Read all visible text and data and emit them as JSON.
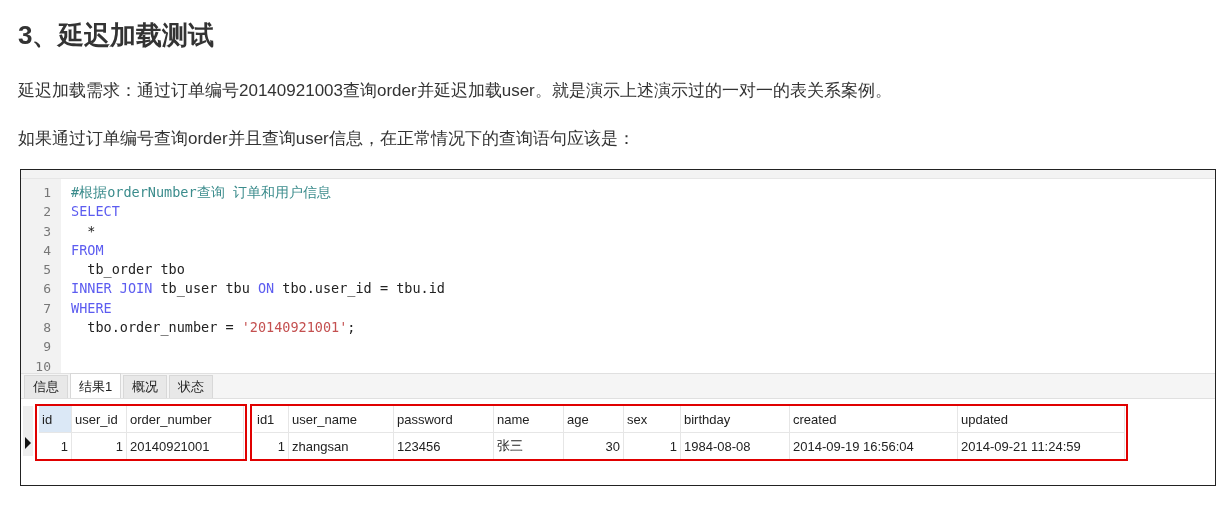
{
  "heading": "3、延迟加载测试",
  "paragraphs": [
    "延迟加载需求：通过订单编号20140921003查询order并延迟加载user。就是演示上述演示过的一对一的表关系案例。",
    "如果通过订单编号查询order并且查询user信息，在正常情况下的查询语句应该是："
  ],
  "editor": {
    "lines": [
      {
        "number": "1",
        "tokens": [
          {
            "kind": "comment",
            "text": "#根据orderNumber查询 订单和用户信息"
          }
        ]
      },
      {
        "number": "2",
        "tokens": [
          {
            "kind": "keyword",
            "text": "SELECT"
          }
        ]
      },
      {
        "number": "3",
        "tokens": [
          {
            "kind": "plain",
            "text": "  *"
          }
        ]
      },
      {
        "number": "4",
        "tokens": [
          {
            "kind": "keyword",
            "text": "FROM"
          }
        ]
      },
      {
        "number": "5",
        "tokens": [
          {
            "kind": "plain",
            "text": "  tb_order tbo"
          }
        ]
      },
      {
        "number": "6",
        "tokens": [
          {
            "kind": "keyword",
            "text": "INNER JOIN"
          },
          {
            "kind": "plain",
            "text": " tb_user tbu "
          },
          {
            "kind": "keyword",
            "text": "ON"
          },
          {
            "kind": "plain",
            "text": " tbo.user_id = tbu.id"
          }
        ]
      },
      {
        "number": "7",
        "tokens": [
          {
            "kind": "keyword",
            "text": "WHERE"
          }
        ]
      },
      {
        "number": "8",
        "tokens": [
          {
            "kind": "plain",
            "text": "  tbo.order_number = "
          },
          {
            "kind": "string",
            "text": "'20140921001'"
          },
          {
            "kind": "plain",
            "text": ";"
          }
        ]
      },
      {
        "number": "9"
      },
      {
        "number": "10"
      }
    ]
  },
  "tabs": [
    {
      "label": "信息",
      "selected": false
    },
    {
      "label": "结果1",
      "selected": true
    },
    {
      "label": "概况",
      "selected": false
    },
    {
      "label": "状态",
      "selected": false
    }
  ],
  "result_groups": [
    {
      "columns": [
        {
          "header": "id",
          "kind": "number",
          "selected": true
        },
        {
          "header": "user_id",
          "kind": "number",
          "selected": false
        },
        {
          "header": "order_number",
          "kind": "text",
          "selected": false
        }
      ],
      "values": [
        "1",
        "1",
        "20140921001"
      ]
    },
    {
      "columns": [
        {
          "header": "id1",
          "kind": "number",
          "selected": false
        },
        {
          "header": "user_name",
          "kind": "text",
          "selected": false
        },
        {
          "header": "password",
          "kind": "text",
          "selected": false
        },
        {
          "header": "name",
          "kind": "text",
          "selected": false
        },
        {
          "header": "age",
          "kind": "number",
          "selected": false
        },
        {
          "header": "sex",
          "kind": "number",
          "selected": false
        },
        {
          "header": "birthday",
          "kind": "text",
          "selected": false
        },
        {
          "header": "created",
          "kind": "text",
          "selected": false
        },
        {
          "header": "updated",
          "kind": "text",
          "selected": false
        }
      ],
      "values": [
        "1",
        "zhangsan",
        "123456",
        "张三",
        "30",
        "1",
        "1984-08-08",
        "2014-09-19 16:56:04",
        "2014-09-21 11:24:59"
      ]
    }
  ]
}
